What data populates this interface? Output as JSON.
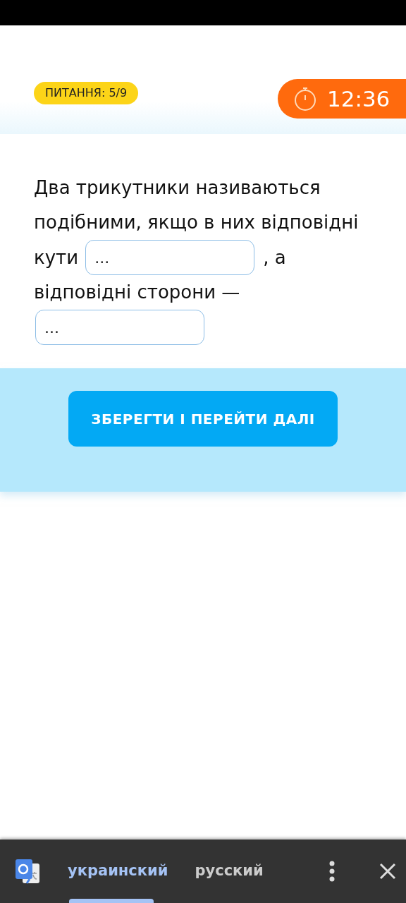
{
  "header": {
    "question_counter": "ПИТАННЯ: 5/9",
    "timer": "12:36"
  },
  "question": {
    "segments": [
      {
        "kind": "text",
        "text": "Два трикутники називаються"
      },
      {
        "kind": "text",
        "text": "подібними, якщо в них відповідні"
      },
      {
        "kind": "text",
        "text": "кути"
      },
      {
        "kind": "blank",
        "placeholder": "..."
      },
      {
        "kind": "text",
        "text": ", а"
      },
      {
        "kind": "text",
        "text": "відповідні сторони —"
      },
      {
        "kind": "blank",
        "placeholder": "..."
      }
    ]
  },
  "save_button": "ЗБЕРЕГТИ І ПЕРЕЙТИ ДАЛІ",
  "translate_bar": {
    "languages": [
      {
        "label": "украинский",
        "selected": true
      },
      {
        "label": "русский",
        "selected": false
      }
    ]
  }
}
